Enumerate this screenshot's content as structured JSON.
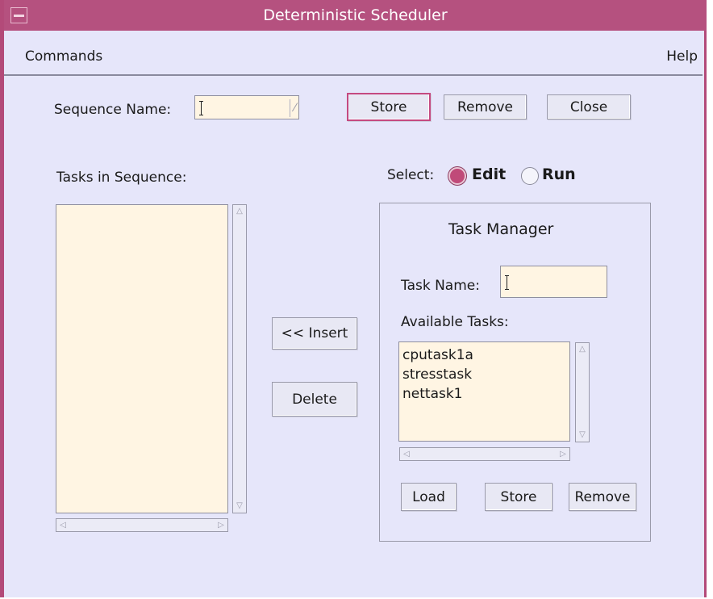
{
  "window": {
    "title": "Deterministic Scheduler"
  },
  "menubar": {
    "commands": "Commands",
    "help": "Help"
  },
  "sequence": {
    "label": "Sequence Name:",
    "value": "",
    "store_label": "Store",
    "remove_label": "Remove",
    "close_label": "Close"
  },
  "tasks_in_sequence": {
    "label": "Tasks in Sequence:",
    "items": []
  },
  "middle": {
    "insert_label": "<< Insert",
    "delete_label": "Delete"
  },
  "select": {
    "label": "Select:",
    "options": [
      "Edit",
      "Run"
    ],
    "selected": "Edit"
  },
  "task_manager": {
    "title": "Task Manager",
    "task_name_label": "Task Name:",
    "task_name_value": "",
    "available_label": "Available Tasks:",
    "available_tasks": [
      "cputask1a",
      "stresstask",
      "nettask1"
    ],
    "load_label": "Load",
    "store_label": "Store",
    "remove_label": "Remove"
  },
  "colors": {
    "accent": "#b5517f",
    "background": "#e6e6fa",
    "field": "#fff5e3"
  },
  "icons": {
    "window_menu": "minimize-bar-icon",
    "dropdown": "dropdown-arrow-icon"
  }
}
